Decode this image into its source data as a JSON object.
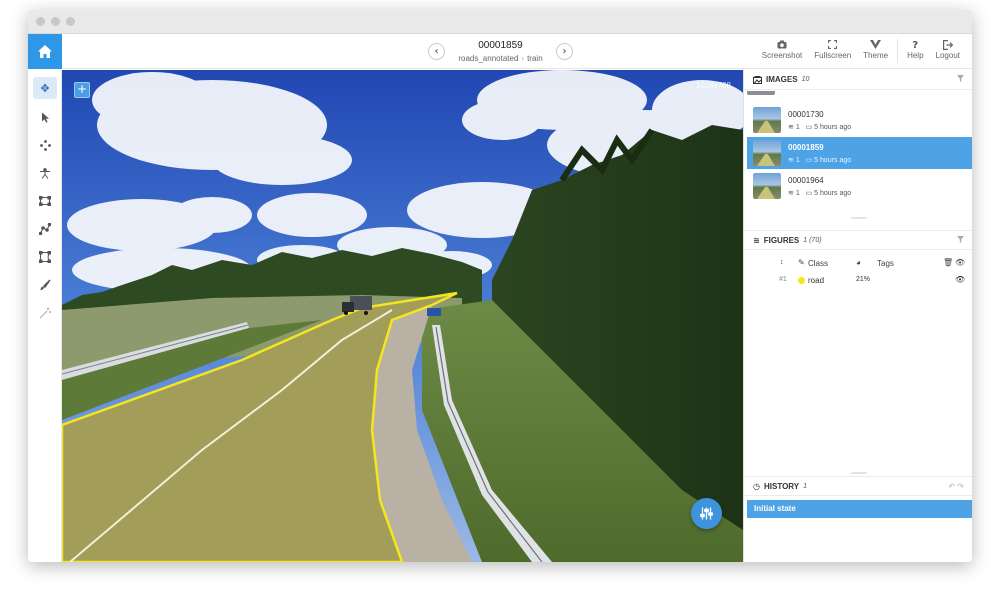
{
  "header": {
    "image_title": "00001859",
    "breadcrumb": {
      "project": "roads_annotated",
      "dataset": "train"
    },
    "prev_icon": "chevron-left-icon",
    "next_icon": "chevron-right-icon",
    "tools": [
      {
        "label": "Screenshot",
        "icon": "camera-icon"
      },
      {
        "label": "Fullscreen",
        "icon": "fullscreen-icon"
      },
      {
        "label": "Theme",
        "icon": "theme-icon"
      },
      {
        "label": "Help",
        "icon": "help-icon"
      },
      {
        "label": "Logout",
        "icon": "logout-icon"
      }
    ],
    "home_icon": "home-icon",
    "accent_color": "#2f97e7"
  },
  "left_toolbar": {
    "tools": [
      "move-icon",
      "pointer-icon",
      "points-icon",
      "skeleton-icon",
      "rectangle-icon",
      "polyline-icon",
      "polygon-icon",
      "brush-icon",
      "smart-tool-icon"
    ],
    "active_index": 0
  },
  "canvas": {
    "image_resolution": "1024x768",
    "plus_icon": "plus-icon",
    "annotation_color": "#f4e51f",
    "fab_icon": "sliders-icon"
  },
  "images_panel": {
    "title": "IMAGES",
    "count": "10",
    "items": [
      {
        "name": "00001730",
        "figures": "1",
        "time": "5 hours ago",
        "selected": false
      },
      {
        "name": "00001859",
        "figures": "1",
        "time": "5 hours ago",
        "selected": true
      },
      {
        "name": "00001964",
        "figures": "1",
        "time": "5 hours ago",
        "selected": false
      }
    ]
  },
  "figures_panel": {
    "title": "FIGURES",
    "count": "1 (70)",
    "columns": {
      "class": "Class",
      "tags": "Tags"
    },
    "rows": [
      {
        "index": "#1",
        "class": "road",
        "area": "21%",
        "color": "#f4e51f"
      }
    ]
  },
  "history_panel": {
    "title": "HISTORY",
    "count": "1",
    "items": [
      "Initial state"
    ]
  }
}
